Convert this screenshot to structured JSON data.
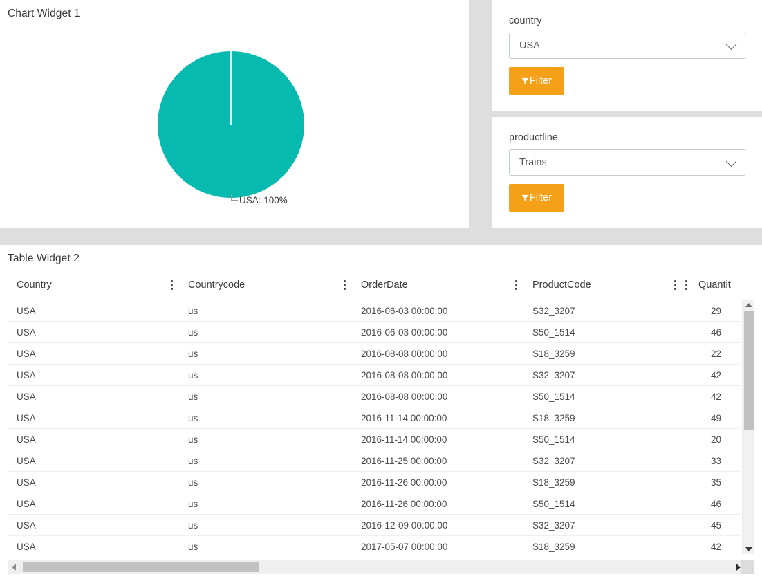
{
  "chart_widget": {
    "title": "Chart Widget 1",
    "accent_color": "#06bab0"
  },
  "chart_data": {
    "type": "pie",
    "title": "Chart Widget 1",
    "categories": [
      "USA"
    ],
    "values": [
      100
    ],
    "labels": [
      "USA: 100%"
    ],
    "colors": [
      "#06bab0"
    ],
    "legend_position": "none",
    "unit": "%"
  },
  "filters": [
    {
      "label": "country",
      "selected": "USA",
      "button_label": "Filter",
      "button_color": "#f5a118",
      "chevron_icon": "chevron-down-icon",
      "funnel_icon": "funnel-icon"
    },
    {
      "label": "productline",
      "selected": "Trains",
      "button_label": "Filter",
      "button_color": "#f5a118",
      "chevron_icon": "chevron-down-icon",
      "funnel_icon": "funnel-icon"
    }
  ],
  "table_widget": {
    "title": "Table Widget 2",
    "columns": [
      "Country",
      "Countrycode",
      "OrderDate",
      "ProductCode",
      "Quantit"
    ],
    "column_menu_icon": "kebab-menu-icon",
    "rows": [
      [
        "USA",
        "us",
        "2016-06-03 00:00:00",
        "S32_3207",
        "29"
      ],
      [
        "USA",
        "us",
        "2016-06-03 00:00:00",
        "S50_1514",
        "46"
      ],
      [
        "USA",
        "us",
        "2016-08-08 00:00:00",
        "S18_3259",
        "22"
      ],
      [
        "USA",
        "us",
        "2016-08-08 00:00:00",
        "S32_3207",
        "42"
      ],
      [
        "USA",
        "us",
        "2016-08-08 00:00:00",
        "S50_1514",
        "42"
      ],
      [
        "USA",
        "us",
        "2016-11-14 00:00:00",
        "S18_3259",
        "49"
      ],
      [
        "USA",
        "us",
        "2016-11-14 00:00:00",
        "S50_1514",
        "20"
      ],
      [
        "USA",
        "us",
        "2016-11-25 00:00:00",
        "S32_3207",
        "33"
      ],
      [
        "USA",
        "us",
        "2016-11-26 00:00:00",
        "S18_3259",
        "35"
      ],
      [
        "USA",
        "us",
        "2016-11-26 00:00:00",
        "S50_1514",
        "46"
      ],
      [
        "USA",
        "us",
        "2016-12-09 00:00:00",
        "S32_3207",
        "45"
      ],
      [
        "USA",
        "us",
        "2017-05-07 00:00:00",
        "S18_3259",
        "42"
      ]
    ],
    "scroll_up_icon": "arrow-up-icon",
    "scroll_down_icon": "arrow-down-icon",
    "scroll_left_icon": "arrow-left-icon",
    "scroll_right_icon": "arrow-right-icon"
  }
}
